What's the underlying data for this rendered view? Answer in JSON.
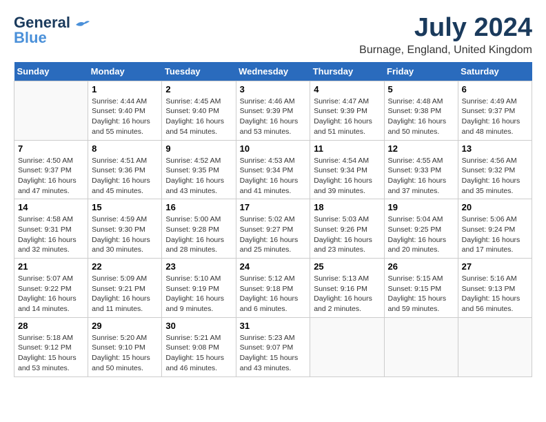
{
  "header": {
    "logo_line1": "General",
    "logo_line2": "Blue",
    "month_title": "July 2024",
    "location": "Burnage, England, United Kingdom"
  },
  "days_of_week": [
    "Sunday",
    "Monday",
    "Tuesday",
    "Wednesday",
    "Thursday",
    "Friday",
    "Saturday"
  ],
  "weeks": [
    [
      {
        "day": "",
        "info": ""
      },
      {
        "day": "1",
        "info": "Sunrise: 4:44 AM\nSunset: 9:40 PM\nDaylight: 16 hours\nand 55 minutes."
      },
      {
        "day": "2",
        "info": "Sunrise: 4:45 AM\nSunset: 9:40 PM\nDaylight: 16 hours\nand 54 minutes."
      },
      {
        "day": "3",
        "info": "Sunrise: 4:46 AM\nSunset: 9:39 PM\nDaylight: 16 hours\nand 53 minutes."
      },
      {
        "day": "4",
        "info": "Sunrise: 4:47 AM\nSunset: 9:39 PM\nDaylight: 16 hours\nand 51 minutes."
      },
      {
        "day": "5",
        "info": "Sunrise: 4:48 AM\nSunset: 9:38 PM\nDaylight: 16 hours\nand 50 minutes."
      },
      {
        "day": "6",
        "info": "Sunrise: 4:49 AM\nSunset: 9:37 PM\nDaylight: 16 hours\nand 48 minutes."
      }
    ],
    [
      {
        "day": "7",
        "info": "Sunrise: 4:50 AM\nSunset: 9:37 PM\nDaylight: 16 hours\nand 47 minutes."
      },
      {
        "day": "8",
        "info": "Sunrise: 4:51 AM\nSunset: 9:36 PM\nDaylight: 16 hours\nand 45 minutes."
      },
      {
        "day": "9",
        "info": "Sunrise: 4:52 AM\nSunset: 9:35 PM\nDaylight: 16 hours\nand 43 minutes."
      },
      {
        "day": "10",
        "info": "Sunrise: 4:53 AM\nSunset: 9:34 PM\nDaylight: 16 hours\nand 41 minutes."
      },
      {
        "day": "11",
        "info": "Sunrise: 4:54 AM\nSunset: 9:34 PM\nDaylight: 16 hours\nand 39 minutes."
      },
      {
        "day": "12",
        "info": "Sunrise: 4:55 AM\nSunset: 9:33 PM\nDaylight: 16 hours\nand 37 minutes."
      },
      {
        "day": "13",
        "info": "Sunrise: 4:56 AM\nSunset: 9:32 PM\nDaylight: 16 hours\nand 35 minutes."
      }
    ],
    [
      {
        "day": "14",
        "info": "Sunrise: 4:58 AM\nSunset: 9:31 PM\nDaylight: 16 hours\nand 32 minutes."
      },
      {
        "day": "15",
        "info": "Sunrise: 4:59 AM\nSunset: 9:30 PM\nDaylight: 16 hours\nand 30 minutes."
      },
      {
        "day": "16",
        "info": "Sunrise: 5:00 AM\nSunset: 9:28 PM\nDaylight: 16 hours\nand 28 minutes."
      },
      {
        "day": "17",
        "info": "Sunrise: 5:02 AM\nSunset: 9:27 PM\nDaylight: 16 hours\nand 25 minutes."
      },
      {
        "day": "18",
        "info": "Sunrise: 5:03 AM\nSunset: 9:26 PM\nDaylight: 16 hours\nand 23 minutes."
      },
      {
        "day": "19",
        "info": "Sunrise: 5:04 AM\nSunset: 9:25 PM\nDaylight: 16 hours\nand 20 minutes."
      },
      {
        "day": "20",
        "info": "Sunrise: 5:06 AM\nSunset: 9:24 PM\nDaylight: 16 hours\nand 17 minutes."
      }
    ],
    [
      {
        "day": "21",
        "info": "Sunrise: 5:07 AM\nSunset: 9:22 PM\nDaylight: 16 hours\nand 14 minutes."
      },
      {
        "day": "22",
        "info": "Sunrise: 5:09 AM\nSunset: 9:21 PM\nDaylight: 16 hours\nand 11 minutes."
      },
      {
        "day": "23",
        "info": "Sunrise: 5:10 AM\nSunset: 9:19 PM\nDaylight: 16 hours\nand 9 minutes."
      },
      {
        "day": "24",
        "info": "Sunrise: 5:12 AM\nSunset: 9:18 PM\nDaylight: 16 hours\nand 6 minutes."
      },
      {
        "day": "25",
        "info": "Sunrise: 5:13 AM\nSunset: 9:16 PM\nDaylight: 16 hours\nand 2 minutes."
      },
      {
        "day": "26",
        "info": "Sunrise: 5:15 AM\nSunset: 9:15 PM\nDaylight: 15 hours\nand 59 minutes."
      },
      {
        "day": "27",
        "info": "Sunrise: 5:16 AM\nSunset: 9:13 PM\nDaylight: 15 hours\nand 56 minutes."
      }
    ],
    [
      {
        "day": "28",
        "info": "Sunrise: 5:18 AM\nSunset: 9:12 PM\nDaylight: 15 hours\nand 53 minutes."
      },
      {
        "day": "29",
        "info": "Sunrise: 5:20 AM\nSunset: 9:10 PM\nDaylight: 15 hours\nand 50 minutes."
      },
      {
        "day": "30",
        "info": "Sunrise: 5:21 AM\nSunset: 9:08 PM\nDaylight: 15 hours\nand 46 minutes."
      },
      {
        "day": "31",
        "info": "Sunrise: 5:23 AM\nSunset: 9:07 PM\nDaylight: 15 hours\nand 43 minutes."
      },
      {
        "day": "",
        "info": ""
      },
      {
        "day": "",
        "info": ""
      },
      {
        "day": "",
        "info": ""
      }
    ]
  ]
}
